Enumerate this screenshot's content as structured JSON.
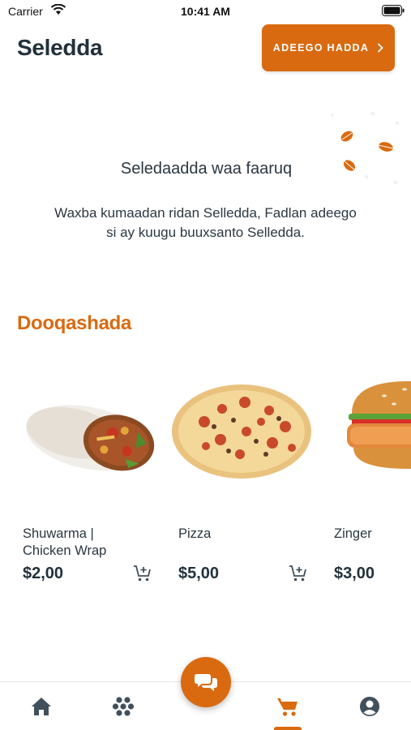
{
  "status_bar": {
    "carrier": "Carrier",
    "time": "10:41 AM"
  },
  "header": {
    "title": "Seledda",
    "order_button_label": "ADEEGO HADDA"
  },
  "empty_cart": {
    "title": "Seledaadda waa faaruq",
    "message": "Waxba kumaadan ridan Selledda, Fadlan adeego si ay kuugu buuxsanto Selledda."
  },
  "store": {
    "section_title": "Dooqashada",
    "products": [
      {
        "name": "Shuwarma | Chicken Wrap",
        "price": "$2,00",
        "image_icon": "shawarma-wrap-image"
      },
      {
        "name": "Pizza",
        "price": "$5,00",
        "image_icon": "pizza-image"
      },
      {
        "name": "Zinger",
        "price": "$3,00",
        "image_icon": "zinger-burger-image"
      }
    ]
  },
  "bottom_nav": {
    "items": [
      {
        "icon": "home-icon"
      },
      {
        "icon": "categories-icon"
      },
      {
        "icon": "cart-icon",
        "active": true
      },
      {
        "icon": "profile-icon"
      }
    ],
    "fab_icon": "chat-icon"
  },
  "colors": {
    "accent": "#d96a10",
    "text_dark": "#22313b",
    "nav_icon": "#40505c"
  }
}
